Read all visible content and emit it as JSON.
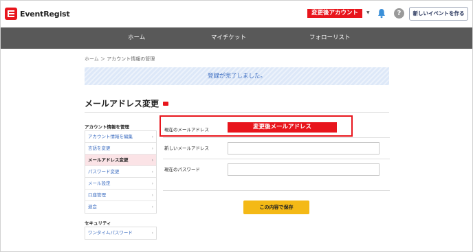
{
  "header": {
    "logo_text": "EventRegist",
    "account_label": "変更後アカウント",
    "help_label": "?",
    "new_event_label": "新しいイベントを作る"
  },
  "nav": {
    "items": [
      {
        "label": "ホーム"
      },
      {
        "label": "マイチケット"
      },
      {
        "label": "フォローリスト"
      }
    ]
  },
  "breadcrumb": "ホーム ＞ アカウント情報の管理",
  "notice": "登録が完了しました。",
  "page_title": "メールアドレス変更",
  "sidebar": {
    "section1_title": "アカウント情報を管理",
    "section1_items": [
      {
        "label": "アカウント情報を編集"
      },
      {
        "label": "言語を変更"
      },
      {
        "label": "メールアドレス変更"
      },
      {
        "label": "パスワード変更"
      },
      {
        "label": "メール設定"
      },
      {
        "label": "口座管理"
      },
      {
        "label": "退会"
      }
    ],
    "section2_title": "セキュリティ",
    "section2_items": [
      {
        "label": "ワンタイムパスワード"
      }
    ]
  },
  "form": {
    "current_email_label": "現在のメールアドレス",
    "current_email_value": "変更後メールアドレス",
    "new_email_label": "新しいメールアドレス",
    "new_email_value": "",
    "current_password_label": "現在のパスワード",
    "current_password_value": "",
    "submit_label": "この内容で保存"
  },
  "colors": {
    "brand_red": "#e8151c",
    "nav_bg": "#595959",
    "notice_bg": "#dde8f8",
    "notice_text": "#3b6cc0",
    "save_button": "#f4b916"
  },
  "icons": [
    "eventregist-logo-icon",
    "chevron-down-icon",
    "bell-icon",
    "help-icon",
    "badge-icon",
    "chevron-right-icon"
  ]
}
